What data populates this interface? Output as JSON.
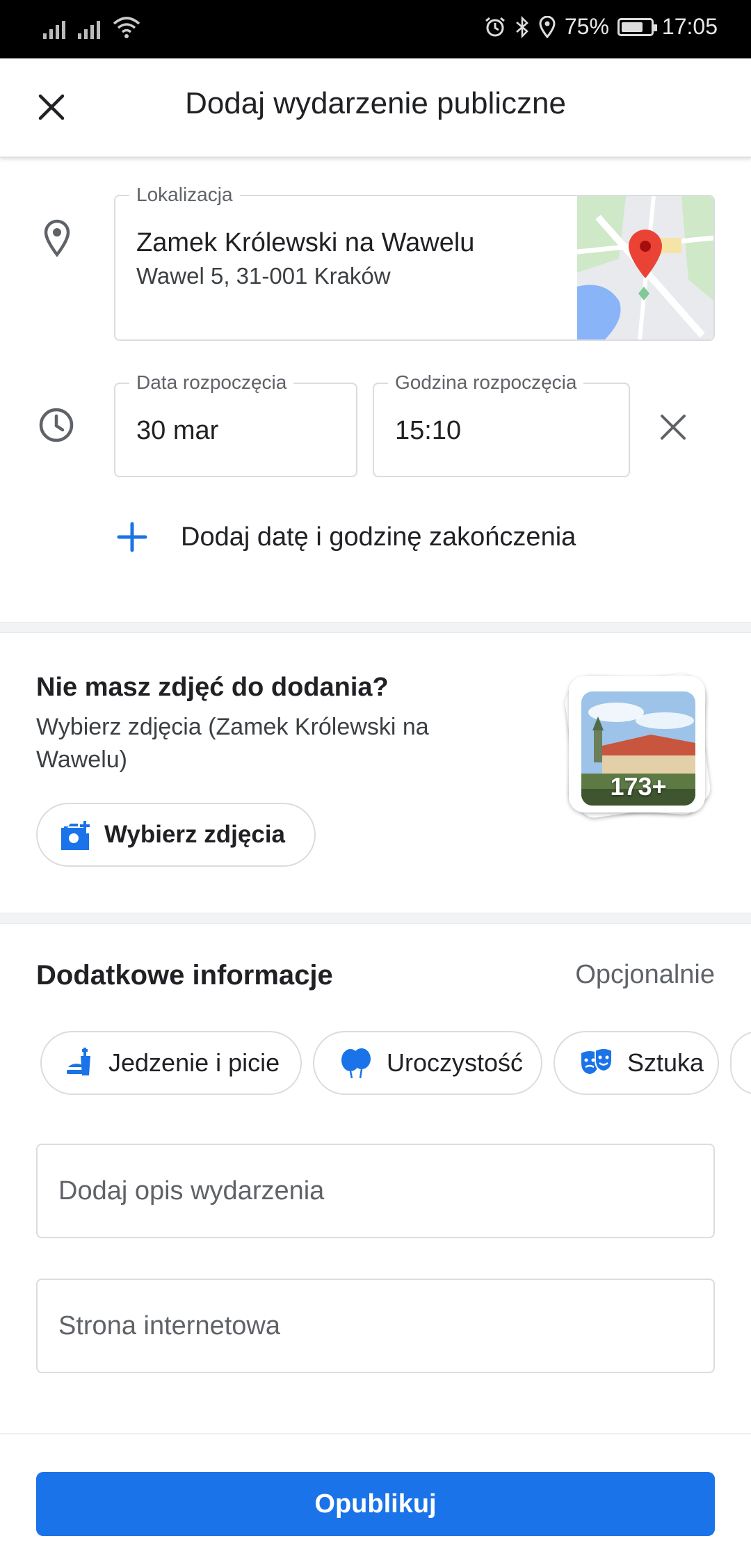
{
  "status_bar": {
    "battery": "75%",
    "time": "17:05",
    "battery_level": 0.75
  },
  "header": {
    "title": "Dodaj wydarzenie publiczne",
    "close_icon": "close-icon"
  },
  "location": {
    "label": "Lokalizacja",
    "name": "Zamek Królewski na Wawelu",
    "address": "Wawel 5, 31-001 Kraków",
    "icon": "location-pin-icon"
  },
  "start": {
    "date_label": "Data rozpoczęcia",
    "date_value": "30 mar",
    "time_label": "Godzina rozpoczęcia",
    "time_value": "15:10",
    "icon": "clock-icon"
  },
  "add_end": {
    "label": "Dodaj datę i godzinę zakończenia"
  },
  "photos": {
    "title": "Nie masz zdjęć do dodania?",
    "subtitle": "Wybierz zdjęcia (Zamek Królewski na Wawelu)",
    "button_label": "Wybierz zdjęcia",
    "count": "173+"
  },
  "extra": {
    "title": "Dodatkowe informacje",
    "optional": "Opcjonalnie",
    "chips": [
      {
        "label": "Jedzenie i picie",
        "icon": "food-drink-icon"
      },
      {
        "label": "Uroczystość",
        "icon": "balloons-icon"
      },
      {
        "label": "Sztuka",
        "icon": "theater-masks-icon"
      }
    ],
    "description_placeholder": "Dodaj opis wydarzenia",
    "website_placeholder": "Strona internetowa"
  },
  "footer": {
    "publish_label": "Opublikuj"
  },
  "colors": {
    "accent": "#1a73e8",
    "pin": "#ea4335",
    "icon_gray": "#5f6368"
  }
}
